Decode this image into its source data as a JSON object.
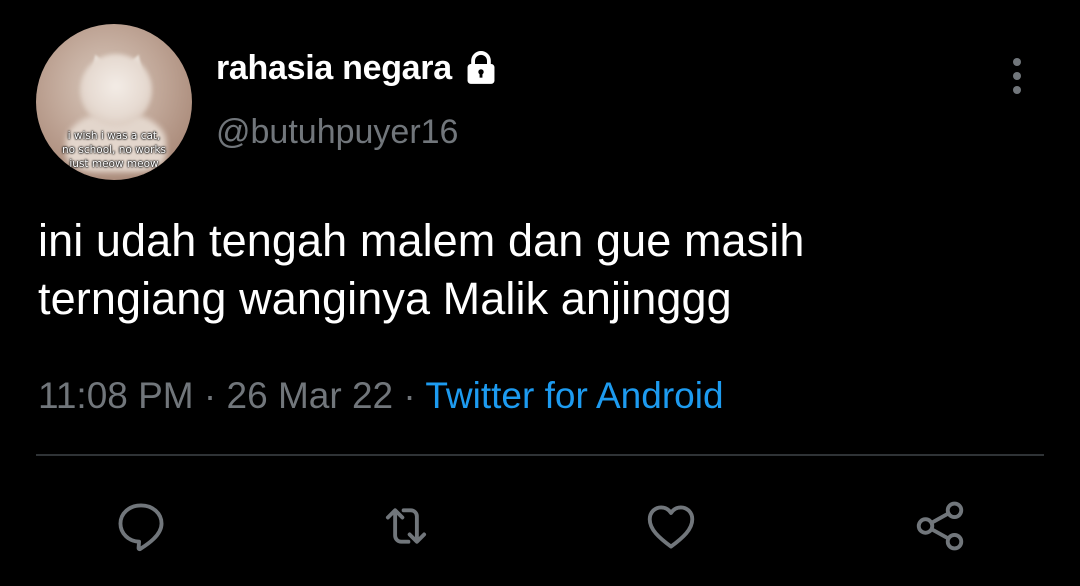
{
  "colors": {
    "background": "#000000",
    "name_text": "#ffffff",
    "secondary_text": "#71767b",
    "link": "#1d9bf0",
    "divider": "#2f3336",
    "icon": "#71767b"
  },
  "user": {
    "display_name": "rahasia negara",
    "handle": "@butuhpuyer16",
    "protected_icon": "lock-icon",
    "avatar_caption_lines": [
      "i wish i was a cat,",
      "no school, no works",
      "just meow meow"
    ]
  },
  "tweet": {
    "text_lines": [
      "ini udah tengah malem dan gue masih",
      "terngiang wanginya Malik anjinggg"
    ],
    "time": "11:08 PM",
    "separator": "·",
    "date": "26 Mar 22",
    "source": "Twitter for Android"
  },
  "actions": [
    {
      "name": "reply",
      "icon": "reply-icon"
    },
    {
      "name": "retweet",
      "icon": "retweet-icon"
    },
    {
      "name": "like",
      "icon": "heart-icon"
    },
    {
      "name": "share",
      "icon": "share-icon"
    }
  ],
  "menu": {
    "icon": "more-vertical-icon"
  }
}
